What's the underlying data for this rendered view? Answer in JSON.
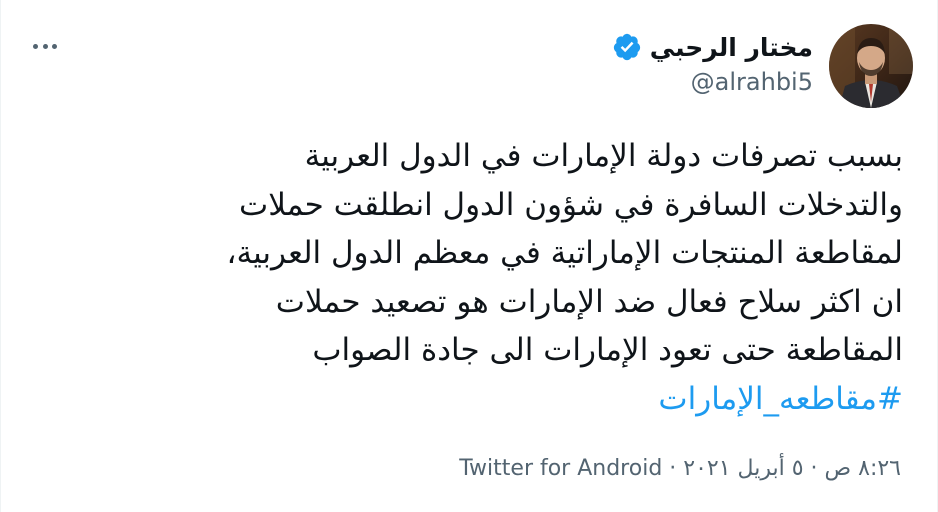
{
  "author": {
    "display_name": "مختار الرحبي",
    "handle": "@alrahbi5",
    "verified": true
  },
  "more_icon": "more-horizontal-icon",
  "tweet": {
    "lines": [
      "بسبب تصرفات دولة الإمارات في الدول العربية",
      "والتدخلات السافرة في شؤون الدول انطلقت حملات",
      "لمقاطعة المنتجات الإماراتية في معظم الدول العربية،",
      "ان اكثر سلاح فعال ضد الإمارات هو تصعيد حملات",
      "المقاطعة حتى تعود الإمارات الى جادة الصواب"
    ],
    "hashtag": "#مقاطعه_الإمارات"
  },
  "meta": {
    "time": "٨:٢٦ ص",
    "separator": "·",
    "date": "٥ أبريل ٢٠٢١",
    "source": "Twitter for Android"
  },
  "colors": {
    "text": "#0f1419",
    "secondary": "#536471",
    "link": "#1d9bf0",
    "verified": "#1d9bf0"
  }
}
